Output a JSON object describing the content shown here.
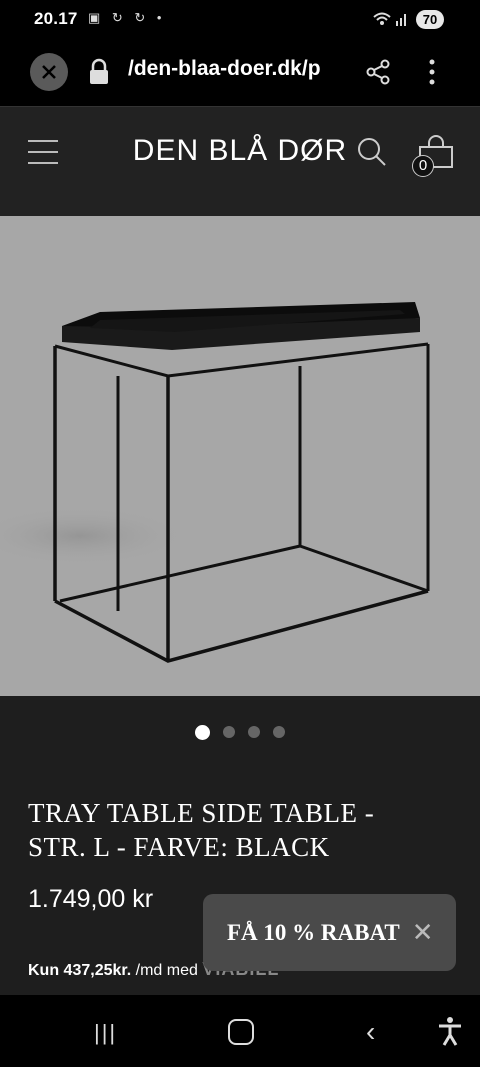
{
  "status_bar": {
    "time": "20.17",
    "battery": "70"
  },
  "browser": {
    "url": "/den-blaa-doer.dk/p"
  },
  "header": {
    "logo": "DEN BLÅ DØR",
    "cart_count": "0"
  },
  "carousel": {
    "dots": 4,
    "active_index": 0
  },
  "product": {
    "title_line1": "TRAY TABLE SIDE TABLE -",
    "title_line2": "STR. L - FARVE: BLACK",
    "price": "1.749,00 kr",
    "installment_amount": "Kun 437,25kr.",
    "installment_suffix": " /md med ",
    "installment_provider": "VIABILL"
  },
  "popup": {
    "text": "FÅ 10 % RABAT"
  },
  "colors": {
    "background": "#1e1e1e",
    "image_bg": "#a7a7a7",
    "popup_bg": "#4a4a4a"
  }
}
